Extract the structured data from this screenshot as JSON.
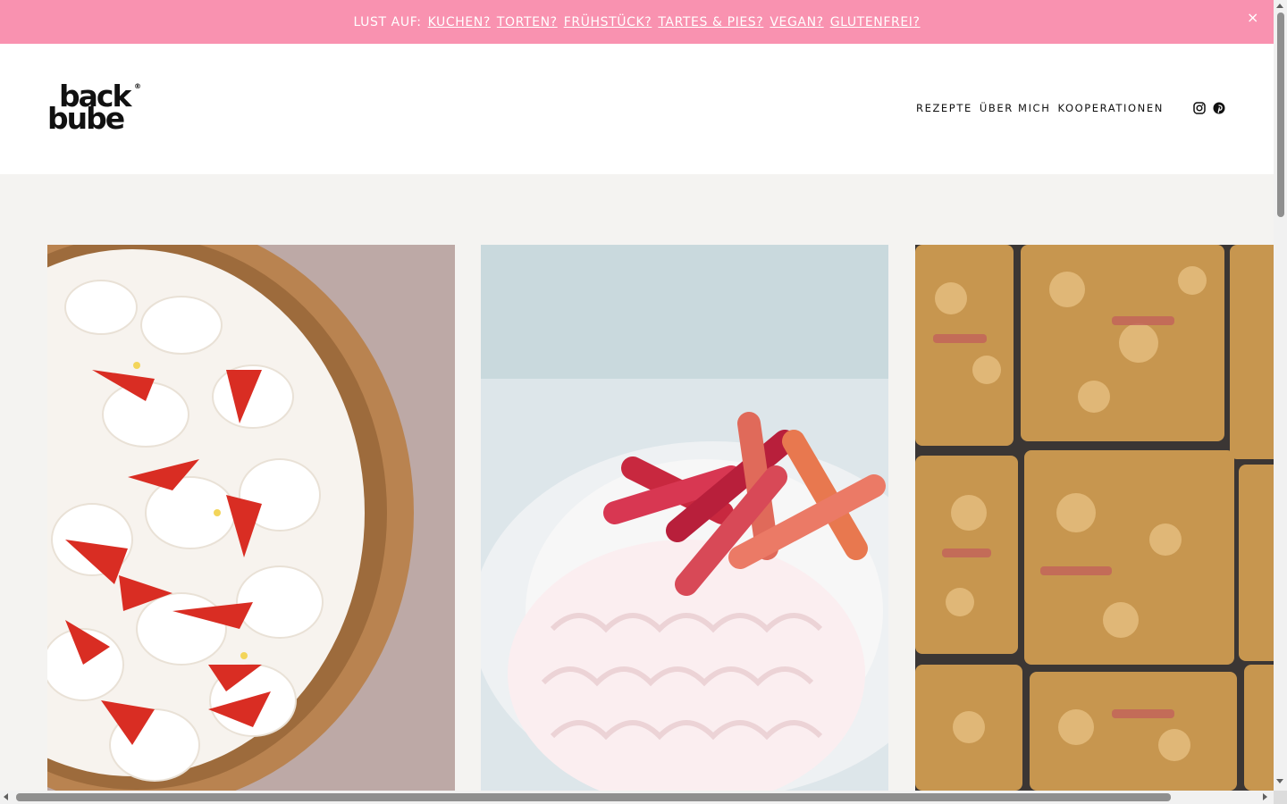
{
  "announcement": {
    "prefix": "LUST AUF:",
    "links": [
      "KUCHEN?",
      "TORTEN?",
      "FRÜHSTÜCK?",
      "TARTES & PIES?",
      "VEGAN?",
      "GLUTENFREI?"
    ],
    "close": "×",
    "background": "#f992b0"
  },
  "header": {
    "logo_line1": "back",
    "logo_line2": "bube",
    "logo_mark": "®",
    "nav": [
      "REZEPTE",
      "ÜBER MICH",
      "KOOPERATIONEN"
    ],
    "social_icons": [
      "instagram-icon",
      "pinterest-icon"
    ]
  },
  "recipes": [
    {
      "image": "strawberry-cream-tart-photo"
    },
    {
      "image": "rhubarb-meringue-photo"
    },
    {
      "image": "rhubarb-crumble-bars-photo"
    }
  ]
}
